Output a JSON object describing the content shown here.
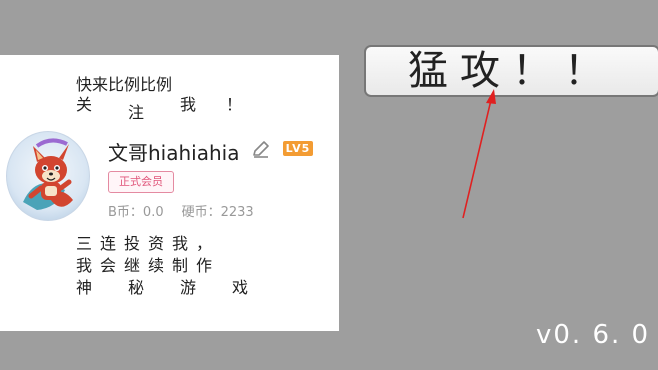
{
  "profile_card": {
    "intro_line1": "快来比例比例",
    "intro_line2": [
      "关",
      "注",
      "我",
      "！"
    ],
    "username": "文哥hiahiahia",
    "level_badge": "LV5",
    "member_badge": "正式会员",
    "b_coins": "B币：0.0",
    "hard_coins": "硬币：2233",
    "outro_line1": [
      "三",
      "连",
      "投",
      "资",
      "我",
      "，"
    ],
    "outro_line2": [
      "我",
      "会",
      "继",
      "续",
      "制",
      "作"
    ],
    "outro_line3": [
      "神",
      "秘",
      "游",
      "戏"
    ]
  },
  "attack_button": {
    "label": "猛攻！！"
  },
  "version": "v0. 6. 0",
  "colors": {
    "background": "#9e9e9e",
    "level_badge": "#f39c33",
    "member_badge": "#e0557a",
    "arrow": "#e02020"
  }
}
